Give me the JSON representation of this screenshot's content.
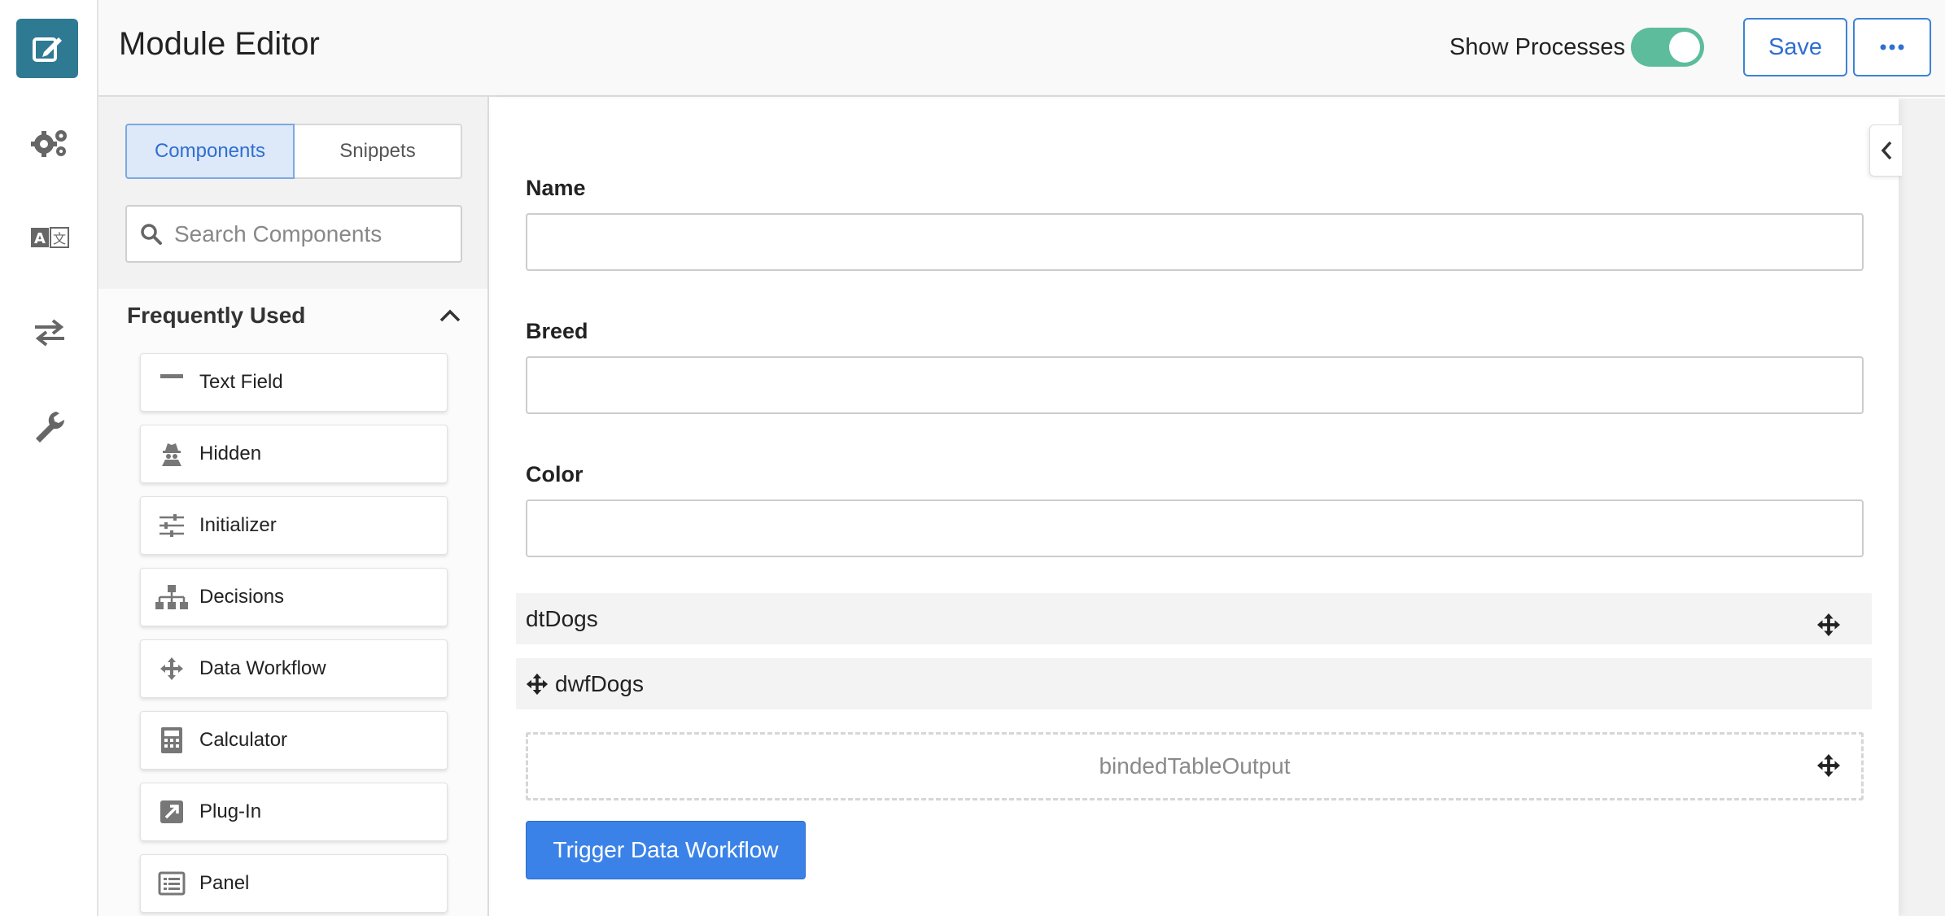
{
  "app": {
    "title": "Module Editor"
  },
  "header": {
    "show_processes_label": "Show Processes",
    "show_processes_on": true,
    "save_label": "Save"
  },
  "rail": {
    "items": [
      "edit-icon",
      "gears-icon",
      "translate-icon",
      "exchange-icon",
      "wrench-icon"
    ]
  },
  "panel": {
    "tabs": [
      "Components",
      "Snippets"
    ],
    "active_tab": "Components",
    "search_placeholder": "Search Components",
    "section_title": "Frequently Used",
    "components": [
      {
        "label": "Text Field",
        "icon": "minus-icon"
      },
      {
        "label": "Hidden",
        "icon": "user-secret-icon"
      },
      {
        "label": "Initializer",
        "icon": "sliders-icon"
      },
      {
        "label": "Decisions",
        "icon": "sitemap-icon"
      },
      {
        "label": "Data Workflow",
        "icon": "arrows-icon"
      },
      {
        "label": "Calculator",
        "icon": "calculator-icon"
      },
      {
        "label": "Plug-In",
        "icon": "external-link-square-icon"
      },
      {
        "label": "Panel",
        "icon": "list-alt-icon"
      }
    ]
  },
  "canvas": {
    "fields": [
      {
        "label": "Name",
        "value": ""
      },
      {
        "label": "Breed",
        "value": ""
      },
      {
        "label": "Color",
        "value": ""
      }
    ],
    "dt_label": "dtDogs",
    "dwf_label": "dwfDogs",
    "drop_label": "bindedTableOutput",
    "trigger_label": "Trigger Data Workflow"
  },
  "colors": {
    "accent": "#3b82e8",
    "rail_active": "#2e7a93",
    "toggle_on": "#5cbc9c"
  }
}
